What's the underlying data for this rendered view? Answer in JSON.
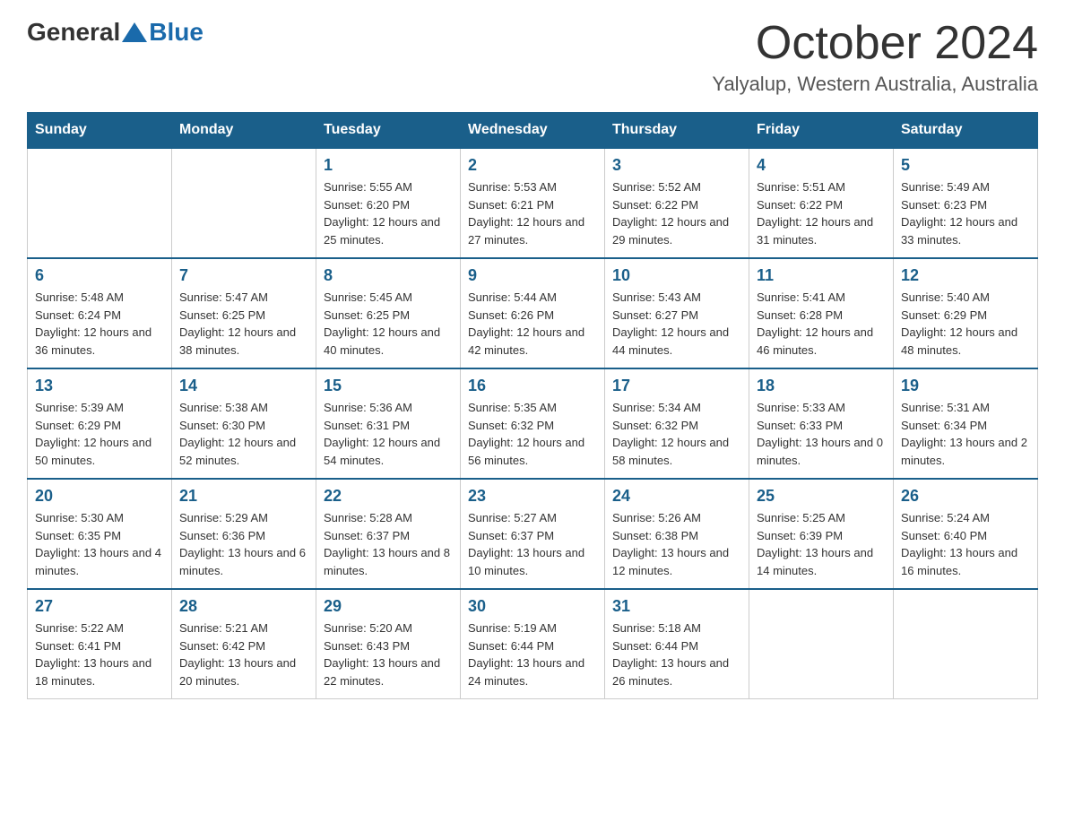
{
  "logo": {
    "general": "General",
    "blue": "Blue"
  },
  "title": "October 2024",
  "subtitle": "Yalyalup, Western Australia, Australia",
  "days_of_week": [
    "Sunday",
    "Monday",
    "Tuesday",
    "Wednesday",
    "Thursday",
    "Friday",
    "Saturday"
  ],
  "weeks": [
    [
      {
        "day": "",
        "sunrise": "",
        "sunset": "",
        "daylight": ""
      },
      {
        "day": "",
        "sunrise": "",
        "sunset": "",
        "daylight": ""
      },
      {
        "day": "1",
        "sunrise": "Sunrise: 5:55 AM",
        "sunset": "Sunset: 6:20 PM",
        "daylight": "Daylight: 12 hours and 25 minutes."
      },
      {
        "day": "2",
        "sunrise": "Sunrise: 5:53 AM",
        "sunset": "Sunset: 6:21 PM",
        "daylight": "Daylight: 12 hours and 27 minutes."
      },
      {
        "day": "3",
        "sunrise": "Sunrise: 5:52 AM",
        "sunset": "Sunset: 6:22 PM",
        "daylight": "Daylight: 12 hours and 29 minutes."
      },
      {
        "day": "4",
        "sunrise": "Sunrise: 5:51 AM",
        "sunset": "Sunset: 6:22 PM",
        "daylight": "Daylight: 12 hours and 31 minutes."
      },
      {
        "day": "5",
        "sunrise": "Sunrise: 5:49 AM",
        "sunset": "Sunset: 6:23 PM",
        "daylight": "Daylight: 12 hours and 33 minutes."
      }
    ],
    [
      {
        "day": "6",
        "sunrise": "Sunrise: 5:48 AM",
        "sunset": "Sunset: 6:24 PM",
        "daylight": "Daylight: 12 hours and 36 minutes."
      },
      {
        "day": "7",
        "sunrise": "Sunrise: 5:47 AM",
        "sunset": "Sunset: 6:25 PM",
        "daylight": "Daylight: 12 hours and 38 minutes."
      },
      {
        "day": "8",
        "sunrise": "Sunrise: 5:45 AM",
        "sunset": "Sunset: 6:25 PM",
        "daylight": "Daylight: 12 hours and 40 minutes."
      },
      {
        "day": "9",
        "sunrise": "Sunrise: 5:44 AM",
        "sunset": "Sunset: 6:26 PM",
        "daylight": "Daylight: 12 hours and 42 minutes."
      },
      {
        "day": "10",
        "sunrise": "Sunrise: 5:43 AM",
        "sunset": "Sunset: 6:27 PM",
        "daylight": "Daylight: 12 hours and 44 minutes."
      },
      {
        "day": "11",
        "sunrise": "Sunrise: 5:41 AM",
        "sunset": "Sunset: 6:28 PM",
        "daylight": "Daylight: 12 hours and 46 minutes."
      },
      {
        "day": "12",
        "sunrise": "Sunrise: 5:40 AM",
        "sunset": "Sunset: 6:29 PM",
        "daylight": "Daylight: 12 hours and 48 minutes."
      }
    ],
    [
      {
        "day": "13",
        "sunrise": "Sunrise: 5:39 AM",
        "sunset": "Sunset: 6:29 PM",
        "daylight": "Daylight: 12 hours and 50 minutes."
      },
      {
        "day": "14",
        "sunrise": "Sunrise: 5:38 AM",
        "sunset": "Sunset: 6:30 PM",
        "daylight": "Daylight: 12 hours and 52 minutes."
      },
      {
        "day": "15",
        "sunrise": "Sunrise: 5:36 AM",
        "sunset": "Sunset: 6:31 PM",
        "daylight": "Daylight: 12 hours and 54 minutes."
      },
      {
        "day": "16",
        "sunrise": "Sunrise: 5:35 AM",
        "sunset": "Sunset: 6:32 PM",
        "daylight": "Daylight: 12 hours and 56 minutes."
      },
      {
        "day": "17",
        "sunrise": "Sunrise: 5:34 AM",
        "sunset": "Sunset: 6:32 PM",
        "daylight": "Daylight: 12 hours and 58 minutes."
      },
      {
        "day": "18",
        "sunrise": "Sunrise: 5:33 AM",
        "sunset": "Sunset: 6:33 PM",
        "daylight": "Daylight: 13 hours and 0 minutes."
      },
      {
        "day": "19",
        "sunrise": "Sunrise: 5:31 AM",
        "sunset": "Sunset: 6:34 PM",
        "daylight": "Daylight: 13 hours and 2 minutes."
      }
    ],
    [
      {
        "day": "20",
        "sunrise": "Sunrise: 5:30 AM",
        "sunset": "Sunset: 6:35 PM",
        "daylight": "Daylight: 13 hours and 4 minutes."
      },
      {
        "day": "21",
        "sunrise": "Sunrise: 5:29 AM",
        "sunset": "Sunset: 6:36 PM",
        "daylight": "Daylight: 13 hours and 6 minutes."
      },
      {
        "day": "22",
        "sunrise": "Sunrise: 5:28 AM",
        "sunset": "Sunset: 6:37 PM",
        "daylight": "Daylight: 13 hours and 8 minutes."
      },
      {
        "day": "23",
        "sunrise": "Sunrise: 5:27 AM",
        "sunset": "Sunset: 6:37 PM",
        "daylight": "Daylight: 13 hours and 10 minutes."
      },
      {
        "day": "24",
        "sunrise": "Sunrise: 5:26 AM",
        "sunset": "Sunset: 6:38 PM",
        "daylight": "Daylight: 13 hours and 12 minutes."
      },
      {
        "day": "25",
        "sunrise": "Sunrise: 5:25 AM",
        "sunset": "Sunset: 6:39 PM",
        "daylight": "Daylight: 13 hours and 14 minutes."
      },
      {
        "day": "26",
        "sunrise": "Sunrise: 5:24 AM",
        "sunset": "Sunset: 6:40 PM",
        "daylight": "Daylight: 13 hours and 16 minutes."
      }
    ],
    [
      {
        "day": "27",
        "sunrise": "Sunrise: 5:22 AM",
        "sunset": "Sunset: 6:41 PM",
        "daylight": "Daylight: 13 hours and 18 minutes."
      },
      {
        "day": "28",
        "sunrise": "Sunrise: 5:21 AM",
        "sunset": "Sunset: 6:42 PM",
        "daylight": "Daylight: 13 hours and 20 minutes."
      },
      {
        "day": "29",
        "sunrise": "Sunrise: 5:20 AM",
        "sunset": "Sunset: 6:43 PM",
        "daylight": "Daylight: 13 hours and 22 minutes."
      },
      {
        "day": "30",
        "sunrise": "Sunrise: 5:19 AM",
        "sunset": "Sunset: 6:44 PM",
        "daylight": "Daylight: 13 hours and 24 minutes."
      },
      {
        "day": "31",
        "sunrise": "Sunrise: 5:18 AM",
        "sunset": "Sunset: 6:44 PM",
        "daylight": "Daylight: 13 hours and 26 minutes."
      },
      {
        "day": "",
        "sunrise": "",
        "sunset": "",
        "daylight": ""
      },
      {
        "day": "",
        "sunrise": "",
        "sunset": "",
        "daylight": ""
      }
    ]
  ]
}
